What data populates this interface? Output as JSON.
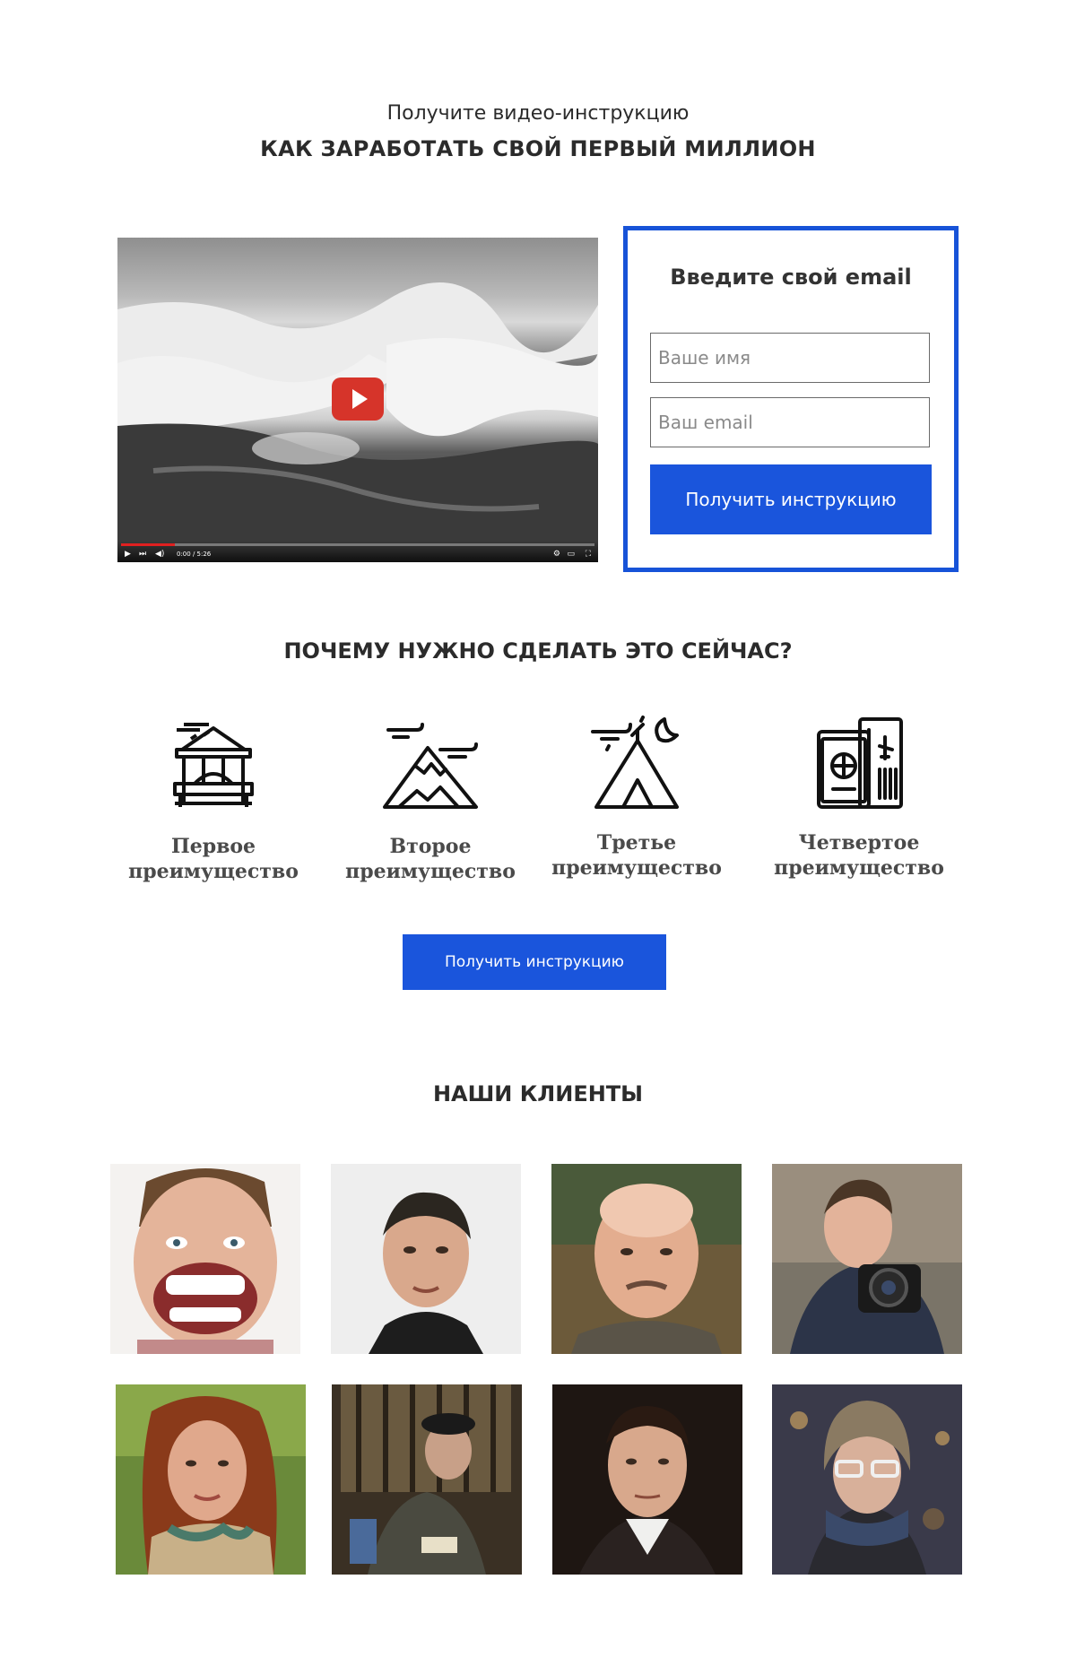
{
  "header": {
    "subtitle": "Получите видео-инструкцию",
    "title": "КАК ЗАРАБОТАТЬ СВОЙ ПЕРВЫЙ МИЛЛИОН"
  },
  "video": {
    "time_label": "0:00 / 5:26",
    "play_icon": "play-icon"
  },
  "form": {
    "title": "Введите свой email",
    "name_placeholder": "Ваше имя",
    "email_placeholder": "Ваш email",
    "submit_label": "Получить инструкцию",
    "border_color": "#1753d8",
    "button_color": "#1a55dc"
  },
  "why": {
    "title": "ПОЧЕМУ НУЖНО СДЕЛАТЬ ЭТО СЕЙЧАС?",
    "benefits": [
      {
        "icon": "gazebo-icon",
        "line1": "Первое",
        "line2": "преимущество"
      },
      {
        "icon": "mountain-icon",
        "line1": "Второе",
        "line2": "преимущество"
      },
      {
        "icon": "tent-icon",
        "line1": "Третье",
        "line2": "преимущество"
      },
      {
        "icon": "passport-ticket-icon",
        "line1": "Четвертое",
        "line2": "преимущество"
      }
    ],
    "cta_label": "Получить инструкцию"
  },
  "clients": {
    "title": "НАШИ КЛИЕНТЫ"
  }
}
